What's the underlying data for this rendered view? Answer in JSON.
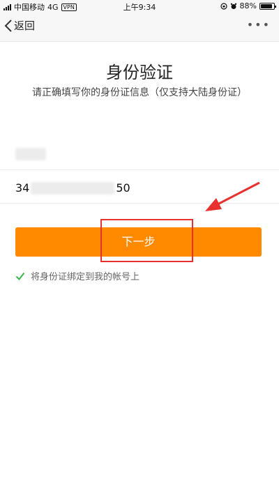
{
  "status_bar": {
    "carrier": "中国移动",
    "network": "4G",
    "vpn": "VPN",
    "time": "上午9:34",
    "battery": "88%",
    "battery_level": 0.88
  },
  "nav": {
    "back_label": "返回",
    "more_label": "•••"
  },
  "page": {
    "title": "身份验证",
    "subtitle": "请正确填写你的身份证信息（仅支持大陆身份证）"
  },
  "form": {
    "id_prefix": "34",
    "id_suffix": "50"
  },
  "actions": {
    "next_label": "下一步"
  },
  "bind_option": {
    "label": "将身份证绑定到我的帐号上",
    "checked": true
  },
  "colors": {
    "accent": "#ff8a00",
    "annotation": "#e8312f",
    "check": "#39b54a"
  }
}
